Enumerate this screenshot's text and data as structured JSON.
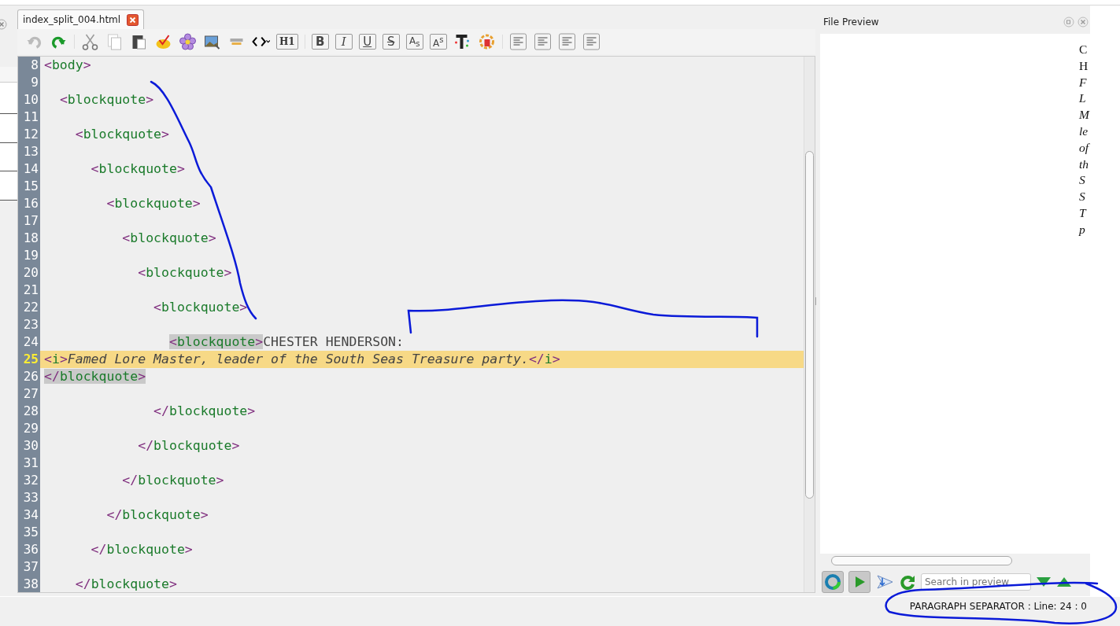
{
  "tab": {
    "label": "index_split_004.html",
    "selected": true
  },
  "toolbar": {
    "heading_button": "H1",
    "format_buttons": [
      {
        "kind": "bold",
        "label": "B"
      },
      {
        "kind": "italic",
        "label": "I"
      },
      {
        "kind": "underline",
        "label": "U"
      },
      {
        "kind": "strike",
        "label": "S"
      },
      {
        "kind": "sub",
        "label": "A$_{s}$"
      },
      {
        "kind": "sup",
        "label": "A$^{s}$"
      }
    ]
  },
  "editor": {
    "lines": [
      {
        "number": "8",
        "selected": false,
        "segments": [
          {
            "kind": "tag",
            "text": "<body>",
            "matched": false
          }
        ]
      },
      {
        "number": "9",
        "selected": false
      },
      {
        "number": "10",
        "selected": false,
        "segments": [
          {
            "kind": "tag",
            "text": "  <blockquote>",
            "matched": false
          }
        ]
      },
      {
        "number": "11",
        "selected": false
      },
      {
        "number": "12",
        "selected": false,
        "segments": [
          {
            "kind": "tag",
            "text": "    <blockquote>",
            "matched": false
          }
        ]
      },
      {
        "number": "13",
        "selected": false
      },
      {
        "number": "14",
        "selected": false,
        "segments": [
          {
            "kind": "tag",
            "text": "      <blockquote>",
            "matched": false
          }
        ]
      },
      {
        "number": "15",
        "selected": false
      },
      {
        "number": "16",
        "selected": false,
        "segments": [
          {
            "kind": "tag",
            "text": "        <blockquote>",
            "matched": false
          }
        ]
      },
      {
        "number": "17",
        "selected": false
      },
      {
        "number": "18",
        "selected": false,
        "segments": [
          {
            "kind": "tag",
            "text": "          <blockquote>",
            "matched": false
          }
        ]
      },
      {
        "number": "19",
        "selected": false
      },
      {
        "number": "20",
        "selected": false,
        "segments": [
          {
            "kind": "tag",
            "text": "            <blockquote>",
            "matched": false
          }
        ]
      },
      {
        "number": "21",
        "selected": false
      },
      {
        "number": "22",
        "selected": false,
        "segments": [
          {
            "kind": "tag",
            "text": "              <blockquote>",
            "matched": false
          }
        ]
      },
      {
        "number": "23",
        "selected": false
      },
      {
        "number": "24",
        "selected": false,
        "segments": [
          {
            "kind": "tag",
            "text": "                <blockquote>",
            "matched": true
          },
          {
            "kind": "text",
            "text": "CHESTER HENDERSON:"
          }
        ]
      },
      {
        "number": "25",
        "selected": true,
        "segments": [
          {
            "kind": "tag",
            "text": "<i>",
            "matched": false
          },
          {
            "kind": "italic",
            "text": "Famed Lore Master, leader of the South Seas Treasure party."
          },
          {
            "kind": "tag",
            "text": "</i>",
            "matched": false
          }
        ]
      },
      {
        "number": "26",
        "selected": false,
        "segments": [
          {
            "kind": "tag",
            "text": "</blockquote>",
            "matched": true
          }
        ]
      },
      {
        "number": "27",
        "selected": false
      },
      {
        "number": "28",
        "selected": false,
        "segments": [
          {
            "kind": "tag",
            "text": "              </blockquote>",
            "matched": false
          }
        ]
      },
      {
        "number": "29",
        "selected": false
      },
      {
        "number": "30",
        "selected": false,
        "segments": [
          {
            "kind": "tag",
            "text": "            </blockquote>",
            "matched": false
          }
        ]
      },
      {
        "number": "31",
        "selected": false
      },
      {
        "number": "32",
        "selected": false,
        "segments": [
          {
            "kind": "tag",
            "text": "          </blockquote>",
            "matched": false
          }
        ]
      },
      {
        "number": "33",
        "selected": false
      },
      {
        "number": "34",
        "selected": false,
        "segments": [
          {
            "kind": "tag",
            "text": "        </blockquote>",
            "matched": false
          }
        ]
      },
      {
        "number": "35",
        "selected": false
      },
      {
        "number": "36",
        "selected": false,
        "segments": [
          {
            "kind": "tag",
            "text": "      </blockquote>",
            "matched": false
          }
        ]
      },
      {
        "number": "37",
        "selected": false
      },
      {
        "number": "38",
        "selected": false,
        "segments": [
          {
            "kind": "tag",
            "text": "    </blockquote>",
            "matched": false
          }
        ]
      }
    ]
  },
  "preview": {
    "title": "File Preview",
    "lines": [
      {
        "kind": "text",
        "text": "C"
      },
      {
        "kind": "text",
        "text": "H"
      },
      {
        "kind": "italic",
        "text": "F"
      },
      {
        "kind": "italic",
        "text": "L"
      },
      {
        "kind": "italic",
        "text": "M"
      },
      {
        "kind": "italic",
        "text": "le"
      },
      {
        "kind": "italic",
        "text": "of"
      },
      {
        "kind": "italic",
        "text": "th"
      },
      {
        "kind": "italic",
        "text": "S"
      },
      {
        "kind": "italic",
        "text": "S"
      },
      {
        "kind": "italic",
        "text": "T"
      },
      {
        "kind": "italic",
        "text": "p"
      }
    ],
    "search": {
      "placeholder": "Search in preview"
    }
  },
  "status_bar": {
    "text": "PARAGRAPH SEPARATOR : Line: 24 : 0"
  }
}
